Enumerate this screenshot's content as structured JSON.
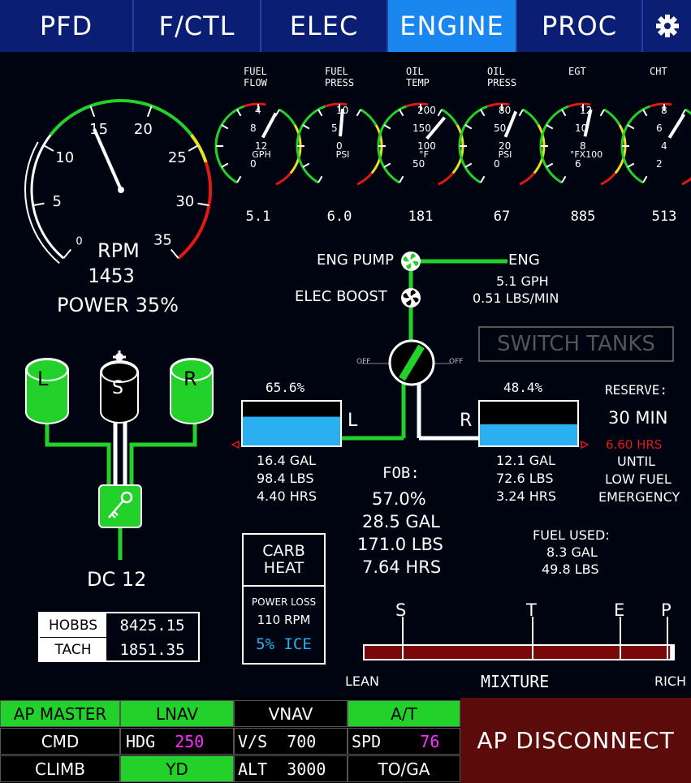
{
  "tabs": [
    {
      "label": "PFD",
      "active": false
    },
    {
      "label": "F/CTL",
      "active": false
    },
    {
      "label": "ELEC",
      "active": false
    },
    {
      "label": "ENGINE",
      "active": true
    },
    {
      "label": "PROC",
      "active": false
    }
  ],
  "settings_icon": "gear-icon",
  "colors": {
    "green": "#22d22a",
    "yellow": "#e8e020",
    "red": "#e01818",
    "fuel_blue": "#2ab0f0",
    "active_tab": "#1a86f0",
    "ap_disconnect": "#5c0b0b"
  },
  "rpm": {
    "ticks": [
      "0",
      "5",
      "10",
      "15",
      "20",
      "25",
      "30",
      "35"
    ],
    "label": "RPM",
    "value": "1453",
    "power": "POWER 35%",
    "needle_rpm": 1453
  },
  "gauges": [
    {
      "id": "fuel-flow",
      "title": [
        "FUEL",
        "FLOW"
      ],
      "unit": "GPH",
      "ticks": [
        "4",
        "8",
        "12",
        "0"
      ],
      "value": "5.1"
    },
    {
      "id": "fuel-press",
      "title": [
        "FUEL",
        "PRESS"
      ],
      "unit": "PSI",
      "ticks": [
        "10",
        "5",
        "0"
      ],
      "value": "6.0"
    },
    {
      "id": "oil-temp",
      "title": [
        "OIL",
        "TEMP"
      ],
      "unit": "°F",
      "ticks": [
        "200",
        "150",
        "100",
        "50"
      ],
      "value": "181"
    },
    {
      "id": "oil-press",
      "title": [
        "OIL",
        "PRESS"
      ],
      "unit": "PSI",
      "ticks": [
        "80",
        "50",
        "20",
        "0"
      ],
      "value": "67"
    },
    {
      "id": "egt",
      "title": [
        "EGT",
        ""
      ],
      "unit": "°FX100",
      "ticks": [
        "12",
        "10",
        "8",
        "6"
      ],
      "value": "885"
    },
    {
      "id": "cht",
      "title": [
        "CHT",
        ""
      ],
      "unit": "",
      "ticks": [
        "8",
        "6",
        "4",
        "2"
      ],
      "value": "513"
    }
  ],
  "pumps": {
    "eng_pump": "ENG PUMP",
    "elec_boost": "ELEC BOOST",
    "eng": "ENG",
    "flow_gph": "5.1 GPH",
    "flow_lbs": "0.51 LBS/MIN"
  },
  "switch_tanks": "SWITCH TANKS",
  "selector": {
    "off_left": "OFF",
    "off_right": "OFF"
  },
  "left_tank": {
    "pct": "65.6%",
    "label": "L",
    "gal": "16.4 GAL",
    "lbs": "98.4 LBS",
    "hrs": "4.40 HRS",
    "fill": 0.656
  },
  "right_tank": {
    "pct": "48.4%",
    "label": "R",
    "gal": "12.1 GAL",
    "lbs": "72.6 LBS",
    "hrs": "3.24 HRS",
    "fill": 0.484
  },
  "reserve": {
    "title": "RESERVE:",
    "time": "30 MIN",
    "hrs": "6.60 HRS",
    "until": "UNTIL",
    "low1": "LOW FUEL",
    "low2": "EMERGENCY"
  },
  "fob": {
    "title": "FOB:",
    "pct": "57.0%",
    "gal": "28.5 GAL",
    "lbs": "171.0 LBS",
    "hrs": "7.64 HRS"
  },
  "fuel_used": {
    "title": "FUEL USED:",
    "gal": "8.3 GAL",
    "lbs": "49.8 LBS"
  },
  "tanks_icons": {
    "left": "L",
    "sel": "S",
    "right": "R"
  },
  "key_icon": "key-icon",
  "dc": "DC 12",
  "hobbs": {
    "label": "HOBBS",
    "value": "8425.15"
  },
  "tach": {
    "label": "TACH",
    "value": "1851.35"
  },
  "carb": {
    "line1": "CARB",
    "line2": "HEAT",
    "loss1": "POWER LOSS",
    "loss2": "110 RPM",
    "ice": "5% ICE"
  },
  "mixture": {
    "marks": [
      "S",
      "T",
      "E",
      "P"
    ],
    "lean": "LEAN",
    "label": "MIXTURE",
    "rich": "RICH",
    "level": 0.99
  },
  "ap": {
    "ap_master": "AP MASTER",
    "lnav": "LNAV",
    "vnav": "VNAV",
    "at": "A/T",
    "cmd": "CMD",
    "hdg_label": "HDG",
    "hdg_val": "250",
    "vs_label": "V/S",
    "vs_val": "700",
    "spd_label": "SPD",
    "spd_val": "76",
    "climb": "CLIMB",
    "yd": "YD",
    "alt_label": "ALT",
    "alt_val": "3000",
    "toga": "TO/GA",
    "disconnect": "AP DISCONNECT"
  }
}
